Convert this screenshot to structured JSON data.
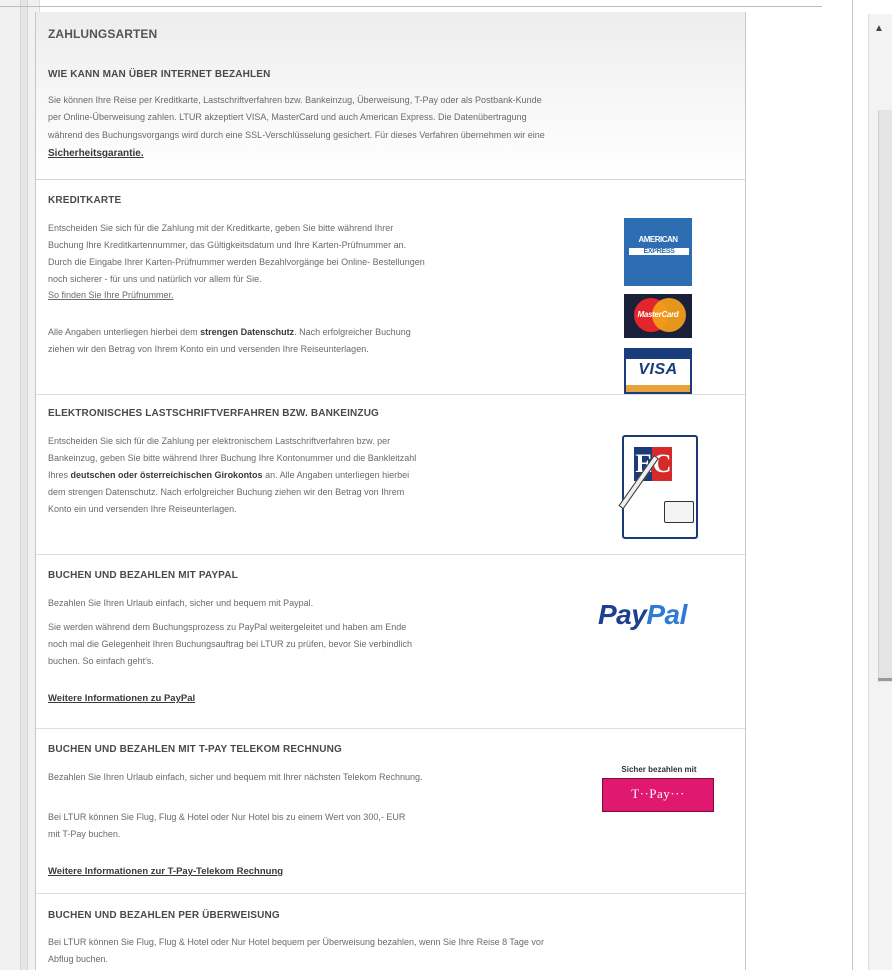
{
  "page": {
    "title": "ZAHLUNGSARTEN",
    "intro": {
      "heading": "WIE KANN MAN ÜBER INTERNET BEZAHLEN",
      "lines": [
        "Sie können Ihre Reise per Kreditkarte, Lastschriftverfahren bzw. Bankeinzug, Überweisung, T-Pay oder als Postbank-Kunde",
        "per Online-Überweisung zahlen. LTUR akzeptiert VISA, MasterCard und auch American Express. Die Datenübertragung",
        "während des Buchungsvorgangs wird durch eine SSL-Verschlüsselung gesichert. Für dieses Verfahren übernehmen wir eine"
      ],
      "link": "Sicherheitsgarantie."
    },
    "kreditkarte": {
      "heading": "KREDITKARTE",
      "lines": [
        "Entscheiden Sie sich für die Zahlung mit der Kreditkarte, geben Sie bitte während Ihrer",
        "Buchung Ihre Kreditkartennummer, das Gültigkeitsdatum und Ihre Karten-Prüfnummer an.",
        "Durch die Eingabe Ihrer Karten-Prüfnummer werden Bezahlvorgänge bei Online- Bestellungen",
        "noch sicherer - für uns und natürlich vor allem für Sie."
      ],
      "link": "So finden Sie Ihre Prüfnummer.",
      "privacy_pre": "Alle Angaben unterliegen hierbei dem ",
      "privacy_bold": "strengen Datenschutz",
      "privacy_post": ". Nach erfolgreicher Buchung",
      "privacy_line2": "ziehen wir den Betrag von Ihrem Konto ein und versenden Ihre Reiseunterlagen.",
      "amex_label_1": "AMERICAN",
      "amex_label_2": "EXPRESS",
      "mc_label": "MasterCard",
      "visa_label": "VISA"
    },
    "lastschrift": {
      "heading": "ELEKTRONISCHES LASTSCHRIFTVERFAHREN BZW. BANKEINZUG",
      "line1": "Entscheiden Sie sich für die Zahlung per elektronischem Lastschriftverfahren bzw. per",
      "line2": "Bankeinzug, geben Sie bitte während Ihrer Buchung Ihre Kontonummer und die Bankleitzahl",
      "line3_pre": "Ihres ",
      "line3_bold": "deutschen oder österreichischen Girokontos",
      "line3_post": " an. Alle Angaben unterliegen hierbei",
      "line4": "dem strengen Datenschutz. Nach erfolgreicher Buchung ziehen wir den Betrag von Ihrem",
      "line5": "Konto ein und versenden Ihre Reiseunterlagen.",
      "ec_e": "E",
      "ec_c": "C"
    },
    "paypal": {
      "heading": "BUCHEN UND BEZAHLEN MIT PAYPAL",
      "line1": "Bezahlen Sie Ihren Urlaub einfach, sicher und bequem mit Paypal.",
      "line2": "Sie werden während dem Buchungsprozess zu PayPal weitergeleitet und haben am Ende",
      "line3": "noch mal die Gelegenheit Ihren Buchungsauftrag bei LTUR zu prüfen, bevor Sie verbindlich",
      "line4": "buchen. So einfach geht's.",
      "link": "Weitere Informationen zu PayPal",
      "logo_pay": "Pay",
      "logo_pal": "Pal"
    },
    "tpay": {
      "heading": "BUCHEN UND BEZAHLEN MIT T-PAY TELEKOM RECHNUNG",
      "line1": "Bezahlen Sie Ihren Urlaub einfach, sicher und bequem mit Ihrer nächsten Telekom Rechnung.",
      "line2": "Bei LTUR können Sie Flug, Flug & Hotel oder Nur Hotel bis zu einem Wert von 300,- EUR",
      "line3": "mit T-Pay buchen.",
      "link": "Weitere Informationen zur T-Pay-Telekom Rechnung",
      "logo_caption": "Sicher bezahlen mit",
      "logo_text": "T··Pay···"
    },
    "ueberweisung": {
      "heading": "BUCHEN UND BEZAHLEN PER ÜBERWEISUNG",
      "line1": "Bei LTUR können Sie Flug, Flug & Hotel oder Nur Hotel bequem per Überweisung bezahlen, wenn Sie Ihre Reise 8 Tage vor",
      "line2": "Abflug buchen."
    }
  },
  "scrollbar": {
    "up_arrow": "▲"
  }
}
